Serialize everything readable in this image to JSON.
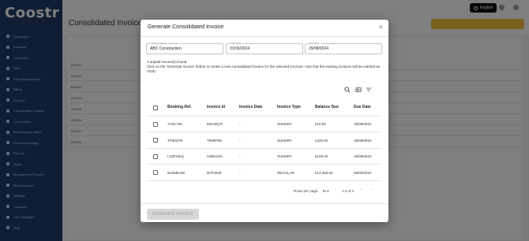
{
  "background": {
    "logo": "Coostr",
    "page_title": "Consolidated Invoices",
    "language": "English",
    "sidebar_items": [
      "Dashboard",
      "Bookings",
      "Customers",
      "Fleet",
      "Price Management",
      "Billing",
      "Invoices",
      "Consolidated Invoices",
      "Credit Notes",
      "Bulk Booking Import",
      "Pending Bookings",
      "Reports",
      "Users",
      "Management Reports",
      "Miscellaneous",
      "Settings",
      "Company",
      "Live Messages",
      "Help"
    ],
    "table_rows": [
      "INV001",
      "INV002",
      "INV003",
      "INV004",
      "INV005",
      "INV006",
      "INV007",
      "INV008"
    ]
  },
  "modal": {
    "title": "Generate Consolidated Invoice",
    "close_glyph": "×",
    "customer_label": "Select business customer *",
    "customer_value": "ABC Construction",
    "start_label": "Start Date",
    "start_value": "01/06/2024",
    "end_label": "End Date",
    "end_value": "29/08/2024",
    "found_text": "4 unpaid invoice(s) found",
    "instruction_text": "Click on the 'Generate invoice' button to create a new consolidated invoice for the selected invoices. note that the existing invoices will be marked as VOID.",
    "columns": [
      "Booking Ref.",
      "Invoice Id",
      "Invoice Date",
      "Invoice Type",
      "Balance Due",
      "Due Date"
    ],
    "rows": [
      {
        "ref": "7A9C700",
        "invoice_id": "B2CWQIT",
        "date": "-",
        "type": "SUNDRY",
        "balance": "£10.00",
        "due": "18/09/2024"
      },
      {
        "ref": "TP60CP6",
        "invoice_id": "T069FRE",
        "date": "-",
        "type": "SUNDRY",
        "balance": "£220.00",
        "due": "18/09/2024"
      },
      {
        "ref": "LXZFHEQ",
        "invoice_id": "O36K2X0",
        "date": "-",
        "type": "SUNDRY",
        "balance": "£100.00",
        "due": "18/09/2024"
      },
      {
        "ref": "6O4ME4W",
        "invoice_id": "9CPJ64P",
        "date": "-",
        "type": "REGULAR",
        "balance": "£13,360.00",
        "due": "26/09/2024"
      }
    ],
    "rows_per_page_label": "Rows per page:",
    "rows_per_page_value": "10",
    "range_text": "1-4 of 4",
    "generate_button": "GENERATE INVOICE"
  }
}
